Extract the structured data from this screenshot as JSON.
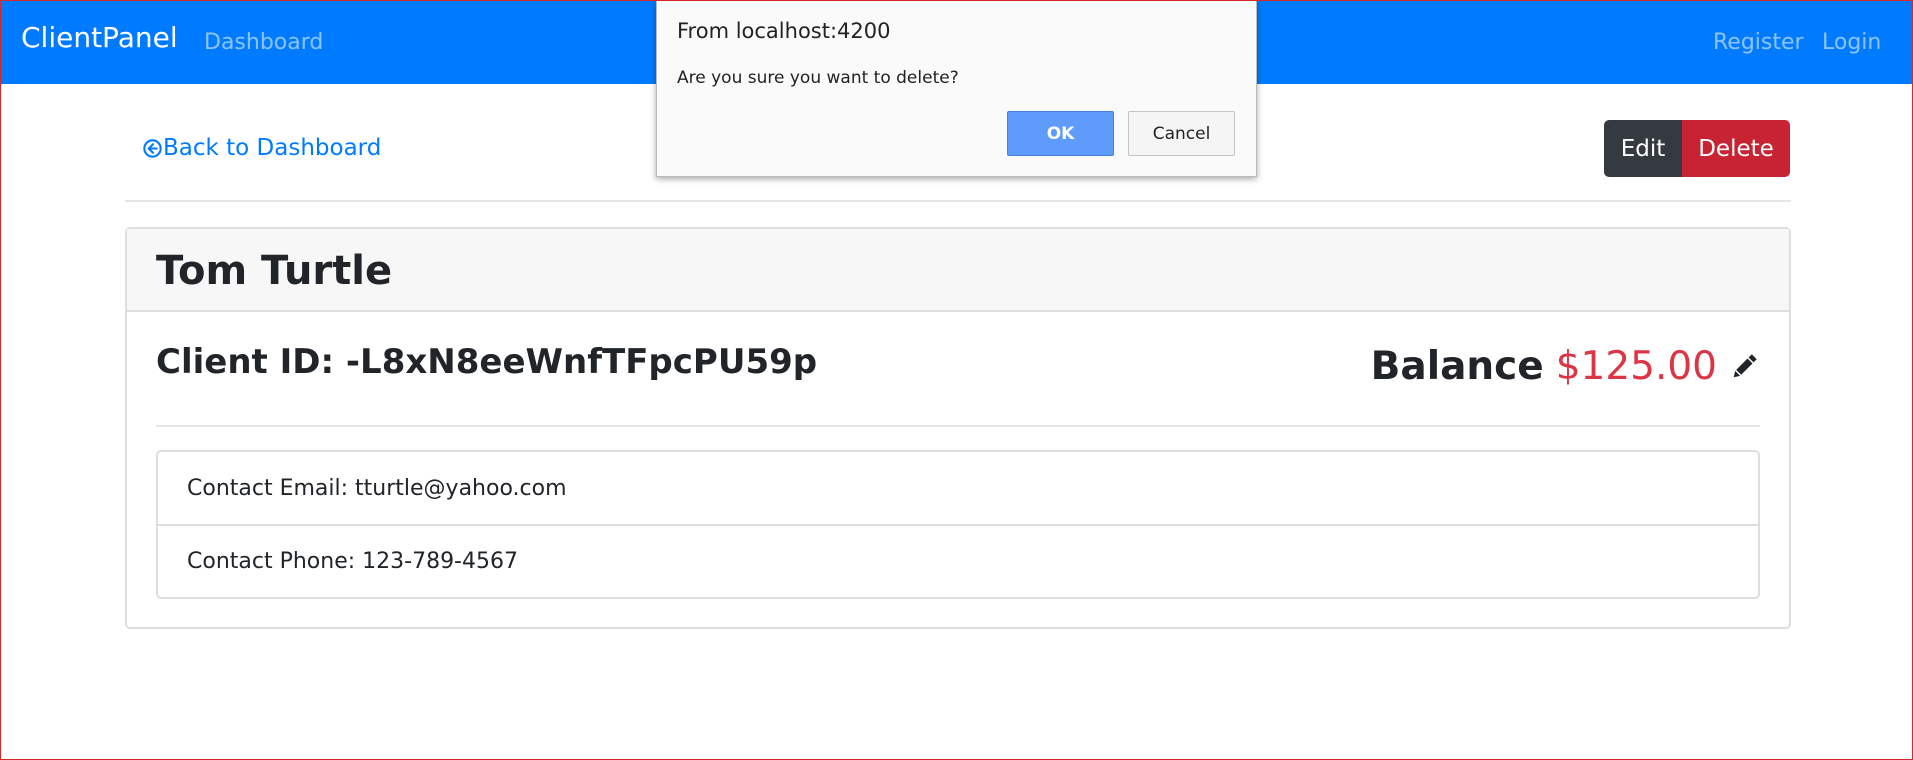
{
  "navbar": {
    "brand": "ClientPanel",
    "links": {
      "dashboard": "Dashboard",
      "register": "Register",
      "login": "Login"
    }
  },
  "page": {
    "back_link": "Back to Dashboard",
    "edit_label": "Edit",
    "delete_label": "Delete"
  },
  "client": {
    "name": "Tom Turtle",
    "id_text": "Client ID: -L8xN8eeWnfTFpcPU59p",
    "balance_label": "Balance",
    "balance_amount": "$125.00",
    "contact_email": "Contact Email: tturtle@yahoo.com",
    "contact_phone": "Contact Phone: 123-789-4567"
  },
  "dialog": {
    "title": "From localhost:4200",
    "message": "Are you sure you want to delete?",
    "ok_label": "OK",
    "cancel_label": "Cancel"
  },
  "colors": {
    "navbar_bg": "#007bff",
    "link": "#007bff",
    "edit_bg": "#343a40",
    "delete_bg": "#c82333",
    "balance_amount": "#dc3545",
    "dialog_ok_bg": "#5f9bfa"
  },
  "icons": {
    "back": "arrow-circle-left-icon",
    "edit_balance": "pencil-icon"
  }
}
